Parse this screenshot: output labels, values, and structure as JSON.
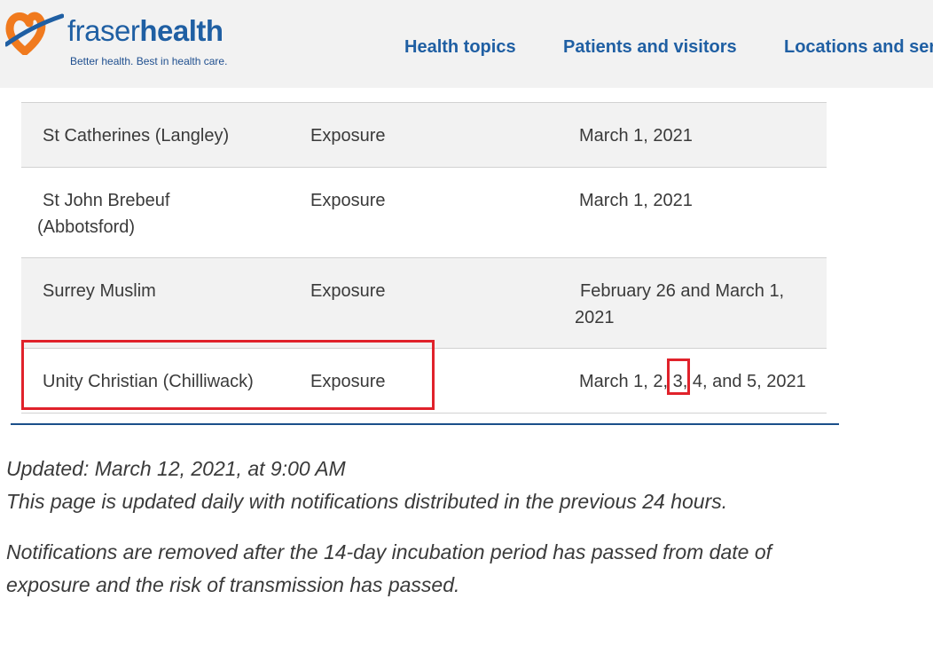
{
  "header": {
    "logo_word_light": "fraser",
    "logo_word_bold": "health",
    "tagline": "Better health. Best in health care.",
    "nav": [
      "Health topics",
      "Patients and visitors",
      "Locations and ser"
    ]
  },
  "table": {
    "rows": [
      {
        "school": "St Catherines (Langley)",
        "type": "Exposure",
        "dates": "March 1, 2021"
      },
      {
        "school_line1": "St John Brebeuf",
        "school_line2": "(Abbotsford)",
        "type": "Exposure",
        "dates": "March 1, 2021"
      },
      {
        "school": "Surrey Muslim",
        "type": "Exposure",
        "dates_line1": "February 26 and March 1,",
        "dates_line2": "2021"
      },
      {
        "school": "Unity Christian (Chilliwack)",
        "type": "Exposure",
        "dates": "March 1, 2, 3, 4, and 5, 2021"
      }
    ]
  },
  "notes": {
    "updated": "Updated: March 12, 2021, at 9:00 AM",
    "daily": "This page is updated daily with notifications distributed in the previous 24 hours.",
    "removed_line1": "Notifications are removed after the 14-day incubation period has passed from date of",
    "removed_line2": "exposure and the risk of transmission has passed."
  },
  "colors": {
    "brand_blue": "#1f5fa3",
    "brand_orange": "#f07a1e",
    "highlight_red": "#e0222b",
    "header_bg": "#f2f2f2"
  }
}
